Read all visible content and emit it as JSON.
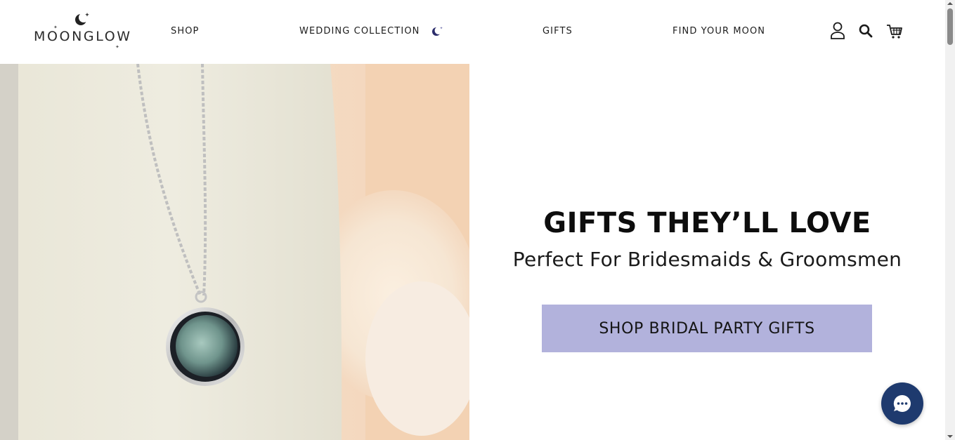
{
  "brand": {
    "name": "MOONGLOW",
    "accent_color": "#b2b2dc",
    "chat_color": "#1e3a6e"
  },
  "nav": {
    "items": [
      {
        "label": "SHOP",
        "icon": null
      },
      {
        "label": "WEDDING COLLECTION",
        "icon": "crescent-moon-icon"
      },
      {
        "label": "GIFTS",
        "icon": null
      },
      {
        "label": "FIND YOUR MOON",
        "icon": null
      }
    ],
    "actions": [
      {
        "name": "account-icon"
      },
      {
        "name": "search-icon"
      },
      {
        "name": "cart-icon"
      }
    ]
  },
  "hero": {
    "image": "moon-phase-pendant-necklace-photo",
    "title": "GIFTS THEY’LL LOVE",
    "subtitle": "Perfect For Bridesmaids & Groomsmen",
    "cta_label": "SHOP BRIDAL PARTY GIFTS"
  },
  "chat": {
    "icon": "chat-dots-icon"
  }
}
